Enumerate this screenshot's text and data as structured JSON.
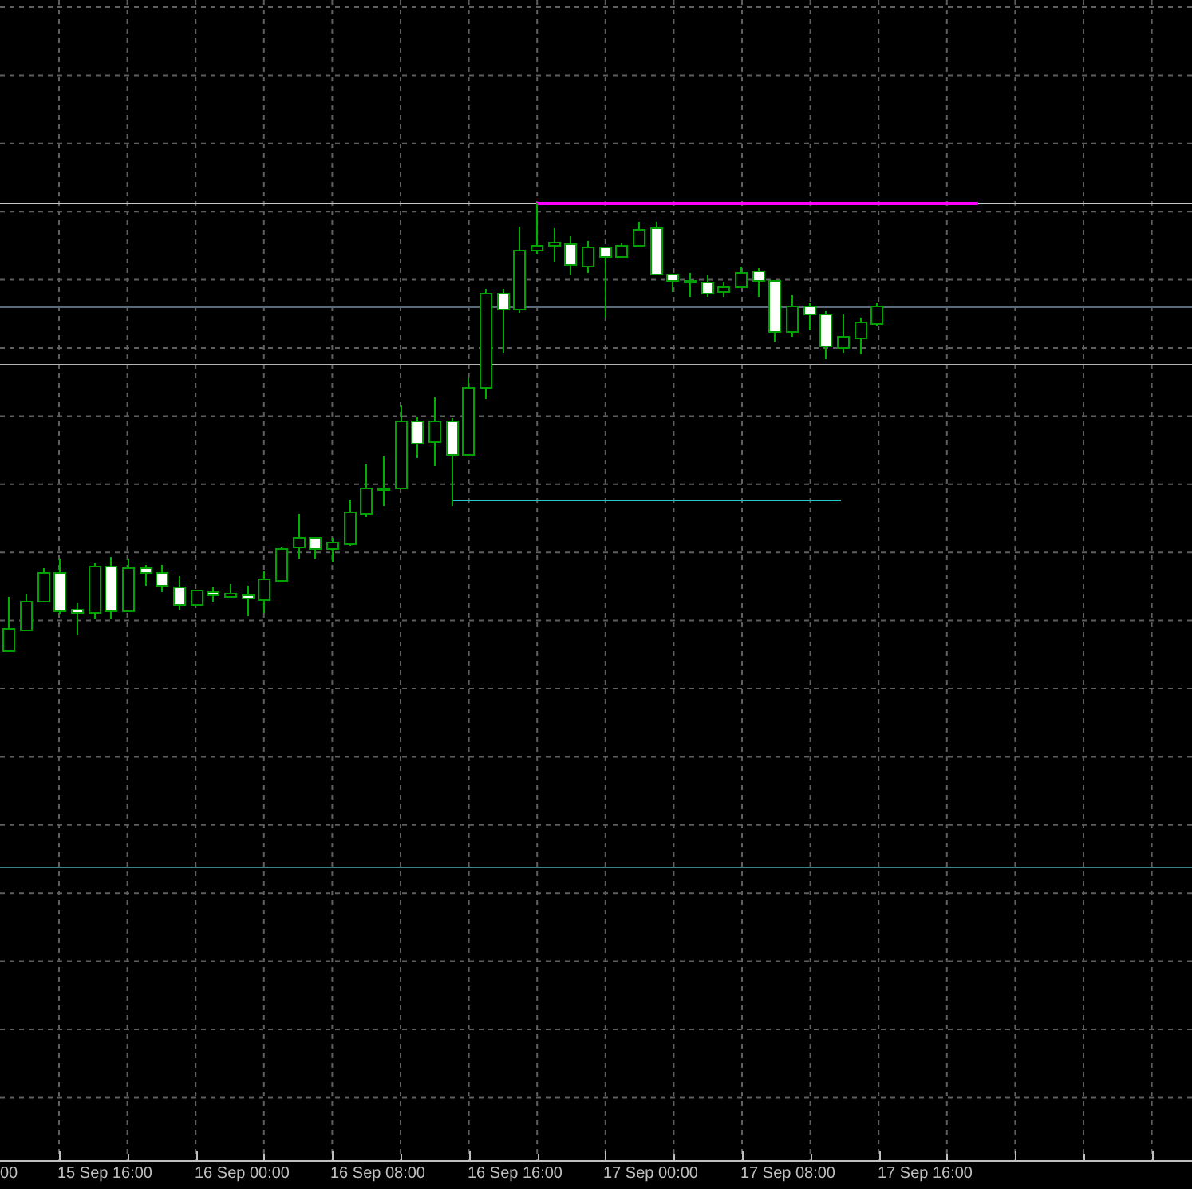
{
  "x_axis": {
    "labels": [
      "00",
      "15 Sep 16:00",
      "16 Sep 00:00",
      "16 Sep 08:00",
      "16 Sep 16:00",
      "17 Sep 00:00",
      "17 Sep 08:00",
      "17 Sep 16:00"
    ]
  }
}
